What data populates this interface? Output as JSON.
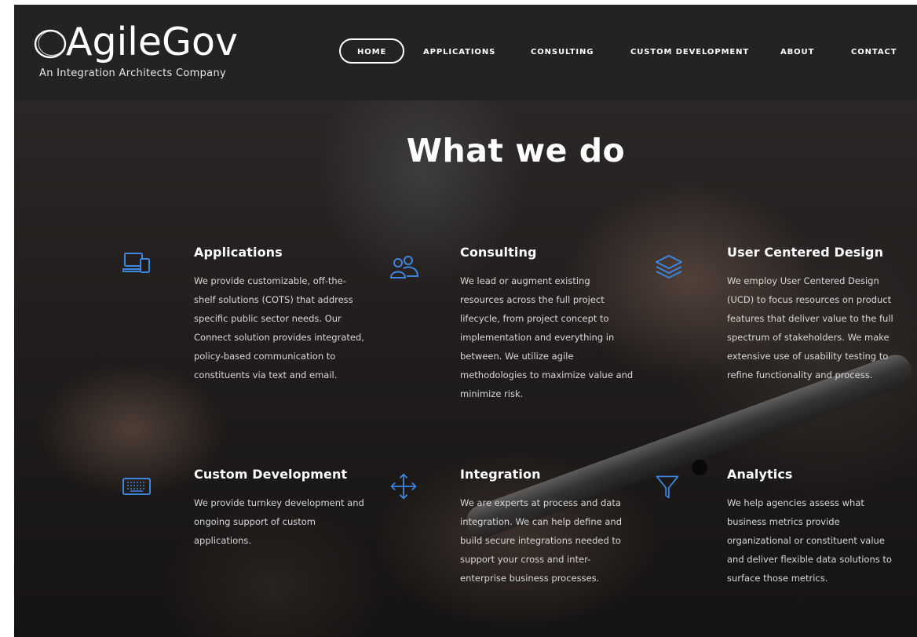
{
  "brand": {
    "name": "AgileGov",
    "tagline": "An Integration Architects Company"
  },
  "nav": {
    "items": [
      {
        "label": "HOME",
        "active": true
      },
      {
        "label": "APPLICATIONS",
        "active": false
      },
      {
        "label": "CONSULTING",
        "active": false
      },
      {
        "label": "CUSTOM DEVELOPMENT",
        "active": false
      },
      {
        "label": "ABOUT",
        "active": false
      },
      {
        "label": "CONTACT",
        "active": false
      }
    ]
  },
  "hero": {
    "title": "What we do"
  },
  "colors": {
    "accent": "#3d86e0",
    "header_bg": "#232323",
    "text": "#ffffff",
    "body_text": "#d8d8d8"
  },
  "services": [
    {
      "title": "Applications",
      "icon": "devices-icon",
      "lines": [
        "We provide customizable, off-the-",
        "shelf solutions (COTS) that address",
        "specific public sector needs. Our",
        "Connect solution provides integrated,",
        "policy-based communication to",
        "constituents via text and email."
      ]
    },
    {
      "title": "Consulting",
      "icon": "people-icon",
      "lines": [
        "We lead or augment existing",
        "resources across the full project",
        "lifecycle, from project concept to",
        "implementation and everything in",
        "between. We utilize agile",
        "methodologies to maximize value and",
        "minimize risk."
      ]
    },
    {
      "title": "User Centered Design",
      "icon": "layers-icon",
      "lines": [
        "We employ User Centered Design",
        "(UCD) to focus resources on product",
        "features that deliver value to the full",
        "spectrum of stakeholders. We make",
        "extensive use of usability testing to",
        "refine functionality and process."
      ]
    },
    {
      "title": "Custom Development",
      "icon": "keyboard-icon",
      "lines": [
        "We provide turnkey development and",
        "ongoing support of custom",
        "applications."
      ]
    },
    {
      "title": "Integration",
      "icon": "move-arrows-icon",
      "lines": [
        "We are experts at process and data",
        "integration. We can help define and",
        "build secure integrations needed to",
        "support your cross and inter-",
        "enterprise business processes."
      ]
    },
    {
      "title": "Analytics",
      "icon": "funnel-icon",
      "lines": [
        "We help agencies assess what",
        "business metrics provide",
        "organizational or constituent value",
        "and deliver flexible data solutions to",
        "surface those metrics."
      ]
    }
  ]
}
